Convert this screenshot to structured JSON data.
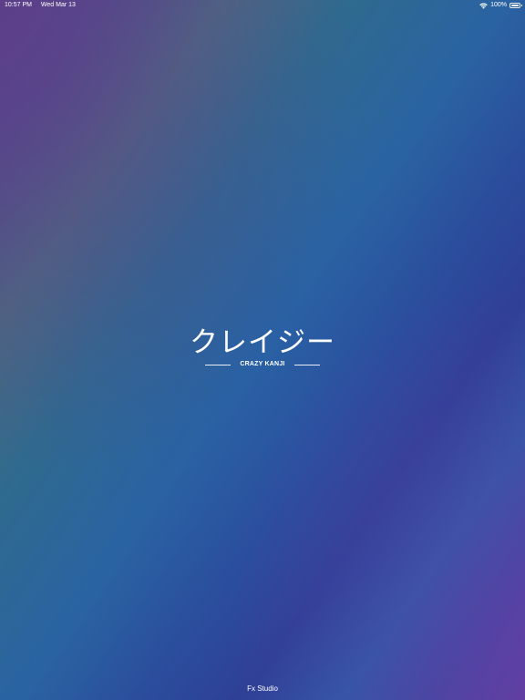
{
  "status_bar": {
    "time": "10:57 PM",
    "date": "Wed Mar 13",
    "battery_percent": "100%",
    "battery_level": 1.0,
    "wifi_icon": "wifi-icon",
    "battery_icon": "battery-icon"
  },
  "logo": {
    "kana": "クレイジー",
    "subtitle": "CRAZY KANJI"
  },
  "footer": {
    "credit": "Fx Studio"
  },
  "colors": {
    "text": "#ffffff",
    "gradient_purple": "#5a3f86",
    "gradient_teal": "#2f6a8e",
    "gradient_blue": "#2a63a2",
    "gradient_deep_blue": "#2e3f95"
  }
}
